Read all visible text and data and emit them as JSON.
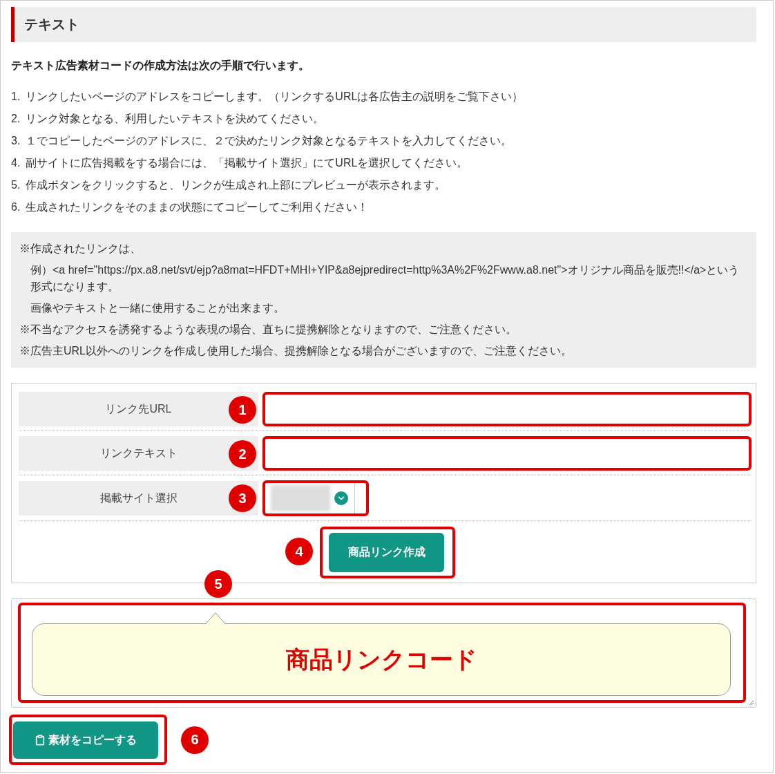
{
  "section": {
    "title": "テキスト"
  },
  "intro": "テキスト広告素材コードの作成方法は次の手順で行います。",
  "steps": [
    {
      "number": "1.",
      "text": "リンクしたいページのアドレスをコピーします。（リンクするURLは各広告主の説明をご覧下さい）"
    },
    {
      "number": "2.",
      "text": "リンク対象となる、利用したいテキストを決めてください。"
    },
    {
      "number": "3.",
      "text": "１でコピーしたページのアドレスに、２で決めたリンク対象となるテキストを入力してください。"
    },
    {
      "number": "4.",
      "text": "副サイトに広告掲載をする場合には、「掲載サイト選択」にてURLを選択してください。"
    },
    {
      "number": "5.",
      "text": "作成ボタンをクリックすると、リンクが生成され上部にプレビューが表示されます。"
    },
    {
      "number": "6.",
      "text": "生成されたリンクをそのままの状態にてコピーしてご利用ください！"
    }
  ],
  "notes": [
    {
      "text": "※作成されたリンクは、",
      "details": [
        "例）<a href=\"https://px.a8.net/svt/ejp?a8mat=HFDT+MHI+YIP&a8ejpredirect=http%3A%2F%2Fwww.a8.net\">オリジナル商品を販売!!</a>という形式になります。",
        "画像やテキストと一緒に使用することが出来ます。"
      ]
    },
    {
      "text": "※不当なアクセスを誘発するような表現の場合、直ちに提携解除となりますので、ご注意ください。"
    },
    {
      "text": "※広告主URL以外へのリンクを作成し使用した場合、提携解除となる場合がございますので、ご注意ください。"
    }
  ],
  "form": {
    "fields": [
      {
        "label": "リンク先URL",
        "kind": "text",
        "badge": "1"
      },
      {
        "label": "リンクテキスト",
        "kind": "text",
        "badge": "2"
      },
      {
        "label": "掲載サイト選択",
        "kind": "select",
        "badge": "3"
      }
    ],
    "submit": {
      "label": "商品リンク作成",
      "badge": "4"
    }
  },
  "output": {
    "text": "商品リンクコード",
    "badge": "5"
  },
  "copy_button": {
    "label": "素材をコピーする",
    "badge": "6"
  }
}
